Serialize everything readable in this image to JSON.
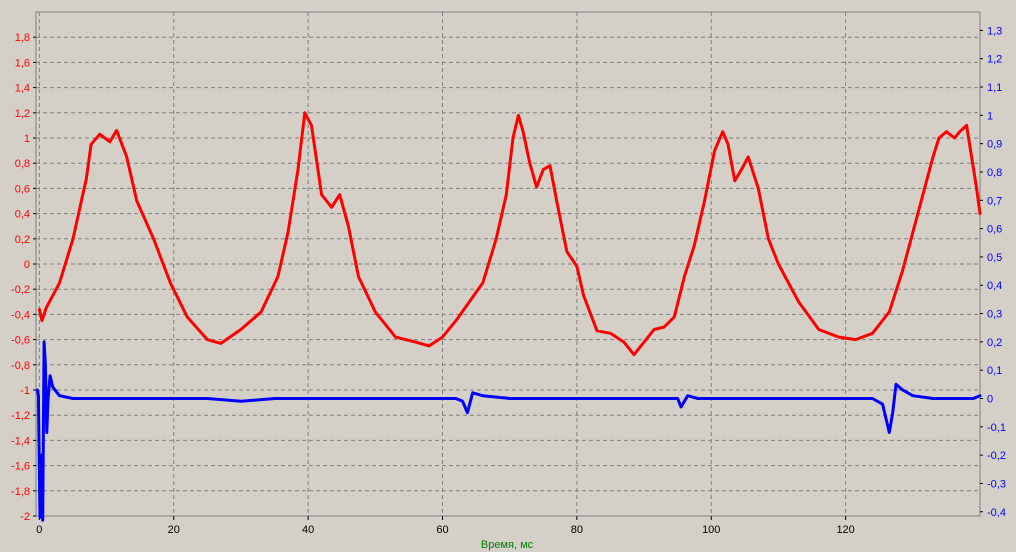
{
  "chart_data": {
    "type": "line",
    "title": "",
    "xlabel": "Время, мс",
    "ylabel": "",
    "y2label": "",
    "xlim": [
      -0.5,
      140
    ],
    "ylim": [
      -2.0,
      2.0
    ],
    "y2lim": [
      -0.415,
      1.365
    ],
    "grid": true,
    "x_ticks": [
      "0",
      "20",
      "40",
      "60",
      "80",
      "100",
      "120"
    ],
    "y_ticks": [
      "-2",
      "-1,8",
      "-1,6",
      "-1,4",
      "-1,2",
      "-1",
      "-0,8",
      "-0,6",
      "-0,4",
      "-0,2",
      "0",
      "0,2",
      "0,4",
      "0,6",
      "0,8",
      "1",
      "1,2",
      "1,4",
      "1,6",
      "1,8"
    ],
    "y2_ticks": [
      "-0,4",
      "-0,3",
      "-0,2",
      "-0,1",
      "0",
      "0,1",
      "0,2",
      "0,3",
      "0,4",
      "0,5",
      "0,6",
      "0,7",
      "0,8",
      "0,9",
      "1",
      "1,1",
      "1,2",
      "1,3"
    ],
    "colors": {
      "series1": "#ff0000",
      "series2": "#0000ff",
      "plot_bg": "#d4d0c8",
      "grid": "#808080",
      "xlabel": "#008000"
    },
    "series": [
      {
        "axis": "left",
        "x": [
          0,
          0.4,
          1,
          3,
          5,
          7,
          7.7,
          9,
          10.5,
          11.5,
          13,
          14.5,
          17,
          19.5,
          22,
          25,
          27,
          30,
          33,
          35.5,
          37,
          38.5,
          39.5,
          40.5,
          42,
          43.5,
          44.7,
          46,
          47.5,
          50,
          53,
          56,
          58,
          60,
          62,
          64,
          66,
          68,
          69.5,
          70.5,
          71.3,
          72,
          73,
          74,
          75,
          76,
          77,
          78.5,
          80,
          81,
          83,
          85,
          87,
          88.5,
          90,
          91.5,
          93,
          94.5,
          96,
          97.5,
          99,
          100.5,
          101.7,
          102.5,
          103.5,
          104.5,
          105.5,
          107,
          108.5,
          110,
          113,
          116,
          119,
          121.5,
          124,
          126.5,
          128.5,
          130,
          131.5,
          133,
          133.9,
          135,
          136.2,
          137,
          138,
          139.5,
          140
        ],
        "values": [
          -0.36,
          -0.45,
          -0.35,
          -0.15,
          0.2,
          0.68,
          0.95,
          1.03,
          0.97,
          1.06,
          0.85,
          0.5,
          0.2,
          -0.15,
          -0.42,
          -0.6,
          -0.63,
          -0.52,
          -0.38,
          -0.1,
          0.25,
          0.75,
          1.2,
          1.1,
          0.55,
          0.45,
          0.55,
          0.3,
          -0.1,
          -0.38,
          -0.58,
          -0.62,
          -0.65,
          -0.58,
          -0.45,
          -0.3,
          -0.15,
          0.2,
          0.55,
          1.0,
          1.18,
          1.05,
          0.8,
          0.61,
          0.75,
          0.78,
          0.5,
          0.1,
          -0.02,
          -0.25,
          -0.53,
          -0.55,
          -0.62,
          -0.72,
          -0.62,
          -0.52,
          -0.5,
          -0.42,
          -0.1,
          0.15,
          0.5,
          0.9,
          1.05,
          0.95,
          0.66,
          0.75,
          0.85,
          0.6,
          0.2,
          0.0,
          -0.3,
          -0.52,
          -0.58,
          -0.6,
          -0.55,
          -0.38,
          -0.05,
          0.25,
          0.55,
          0.85,
          1.0,
          1.05,
          1.0,
          1.05,
          1.1,
          0.6,
          0.4
        ]
      },
      {
        "axis": "right",
        "x": [
          -0.3,
          -0.15,
          0.1,
          0.3,
          0.5,
          0.7,
          0.9,
          1.1,
          1.3,
          1.6,
          2,
          3,
          5,
          10,
          15,
          20,
          25,
          30,
          35,
          40,
          45,
          50,
          55,
          60,
          62,
          63,
          63.7,
          64.5,
          66,
          70,
          75,
          80,
          85,
          90,
          95,
          95.5,
          96.5,
          98,
          100,
          105,
          110,
          115,
          120,
          122,
          124,
          125.5,
          126.5,
          127,
          127.5,
          128.5,
          130,
          133,
          136,
          139,
          140
        ],
        "values": [
          0.03,
          0.01,
          -0.42,
          -0.2,
          -0.43,
          0.2,
          0.12,
          -0.12,
          0.0,
          0.08,
          0.04,
          0.01,
          0.0,
          0.0,
          0.0,
          0.0,
          0.0,
          -0.01,
          0.0,
          0.0,
          0.0,
          0.0,
          0.0,
          0.0,
          0.0,
          -0.01,
          -0.05,
          0.02,
          0.01,
          0.0,
          0.0,
          0.0,
          0.0,
          0.0,
          0.0,
          -0.03,
          0.01,
          0.0,
          0.0,
          0.0,
          0.0,
          0.0,
          0.0,
          0.0,
          0.0,
          -0.02,
          -0.12,
          -0.05,
          0.05,
          0.03,
          0.01,
          0.0,
          0.0,
          0.0,
          0.01
        ]
      }
    ]
  }
}
